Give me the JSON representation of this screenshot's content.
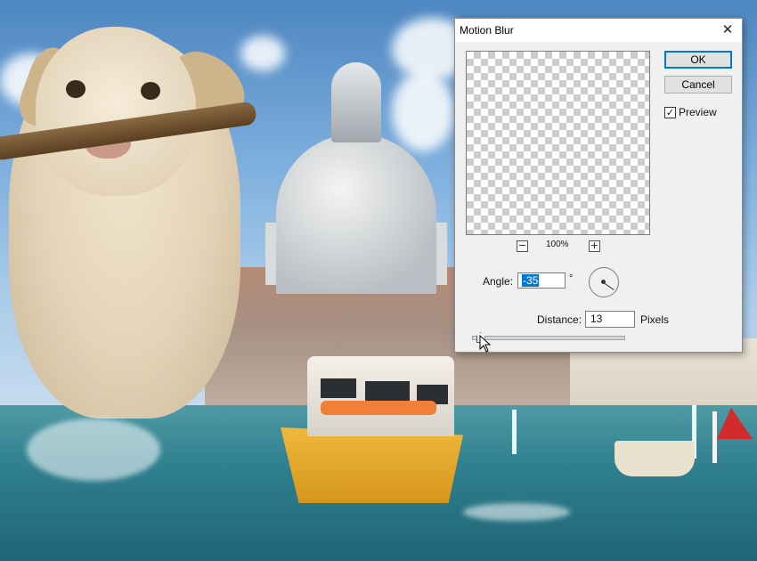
{
  "dialog": {
    "title": "Motion Blur",
    "close_glyph": "✕",
    "ok_label": "OK",
    "cancel_label": "Cancel",
    "preview": {
      "label": "Preview",
      "checked": true,
      "check_glyph": "✓"
    },
    "zoom": {
      "minus": "−",
      "plus": "+",
      "level": "100%"
    },
    "angle": {
      "label": "Angle:",
      "value": "-35",
      "unit": "°"
    },
    "distance": {
      "label": "Distance:",
      "value": "13",
      "unit": "Pixels",
      "slider_fraction": 0.05
    }
  },
  "icons": {
    "close": "close-icon",
    "checkbox": "checkmark-icon",
    "dial": "angle-dial-icon",
    "cursor": "mouse-pointer-icon"
  }
}
